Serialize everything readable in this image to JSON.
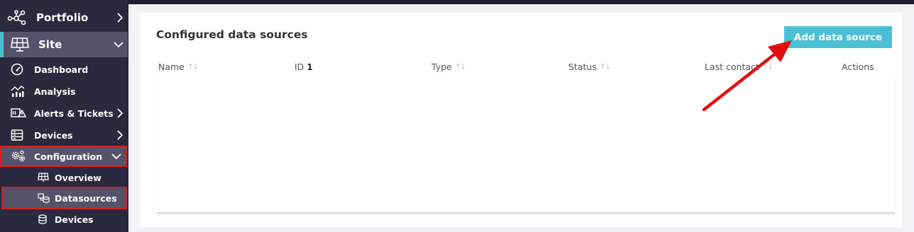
{
  "sidebar": {
    "portfolio": "Portfolio",
    "site": "Site",
    "items": [
      {
        "label": "Dashboard",
        "icon": "gauge-icon"
      },
      {
        "label": "Analysis",
        "icon": "analysis-chart-icon"
      },
      {
        "label": "Alerts & Tickets",
        "icon": "alert-icon"
      },
      {
        "label": "Devices",
        "icon": "server-icon"
      },
      {
        "label": "Configuration",
        "icon": "gears-icon"
      }
    ],
    "config_sub": [
      {
        "label": "Overview",
        "icon": "solar-panel-icon"
      },
      {
        "label": "Datasources",
        "icon": "datasources-icon"
      },
      {
        "label": "Devices",
        "icon": "database-icon"
      }
    ]
  },
  "main": {
    "title": "Configured data sources",
    "add_button": "Add data source",
    "columns": [
      {
        "label": "Name",
        "sort": "none"
      },
      {
        "label": "ID",
        "sort": "1"
      },
      {
        "label": "Type",
        "sort": "none"
      },
      {
        "label": "Status",
        "sort": "none"
      },
      {
        "label": "Last contact",
        "sort": "none"
      },
      {
        "label": "Actions",
        "sort": ""
      }
    ],
    "rows": []
  },
  "colors": {
    "accent": "#4bc0d4",
    "sidebar_bg": "#2b293d",
    "active_bg": "#55536a",
    "highlight": "#d42020"
  }
}
